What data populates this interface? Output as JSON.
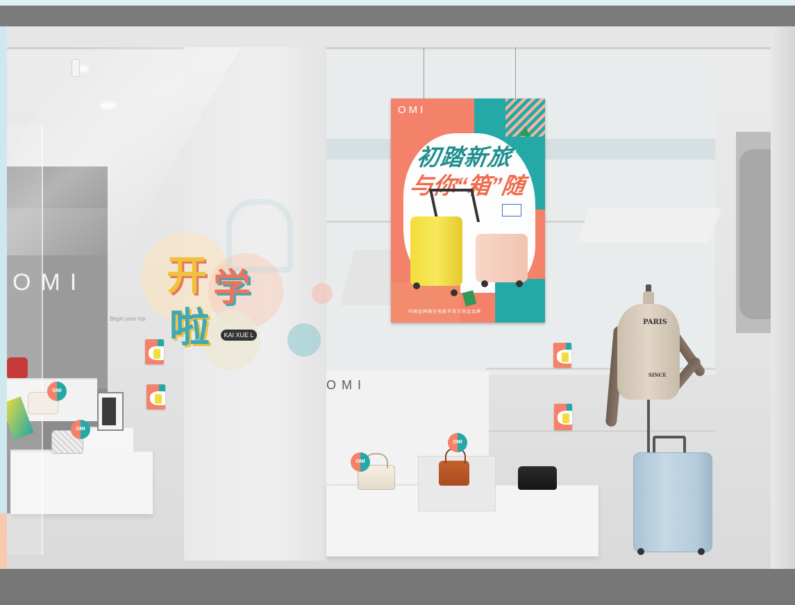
{
  "scene": {
    "left_store_logo": "OMI",
    "center_logo": "OMI",
    "left_window_text": "Begin your trip",
    "poster": {
      "brand": "OMI",
      "title_line1": "初踏新旅",
      "title_line2": "与你“箱”随",
      "footer": "中国金牌箱包电影节官方指定品牌"
    },
    "window_decal": {
      "char1": "开",
      "char2": "学",
      "char3": "啦",
      "badge": "KAI XUE L"
    },
    "badge_text": "OMI",
    "mannequin": {
      "top_text": "PARIS",
      "bottom_text": "SINCE"
    },
    "colors": {
      "poster_orange": "#f4826a",
      "poster_teal": "#25a9a6",
      "poster_yellow": "#f3dd3a",
      "suitcase_blue": "#b5ccdb"
    }
  }
}
